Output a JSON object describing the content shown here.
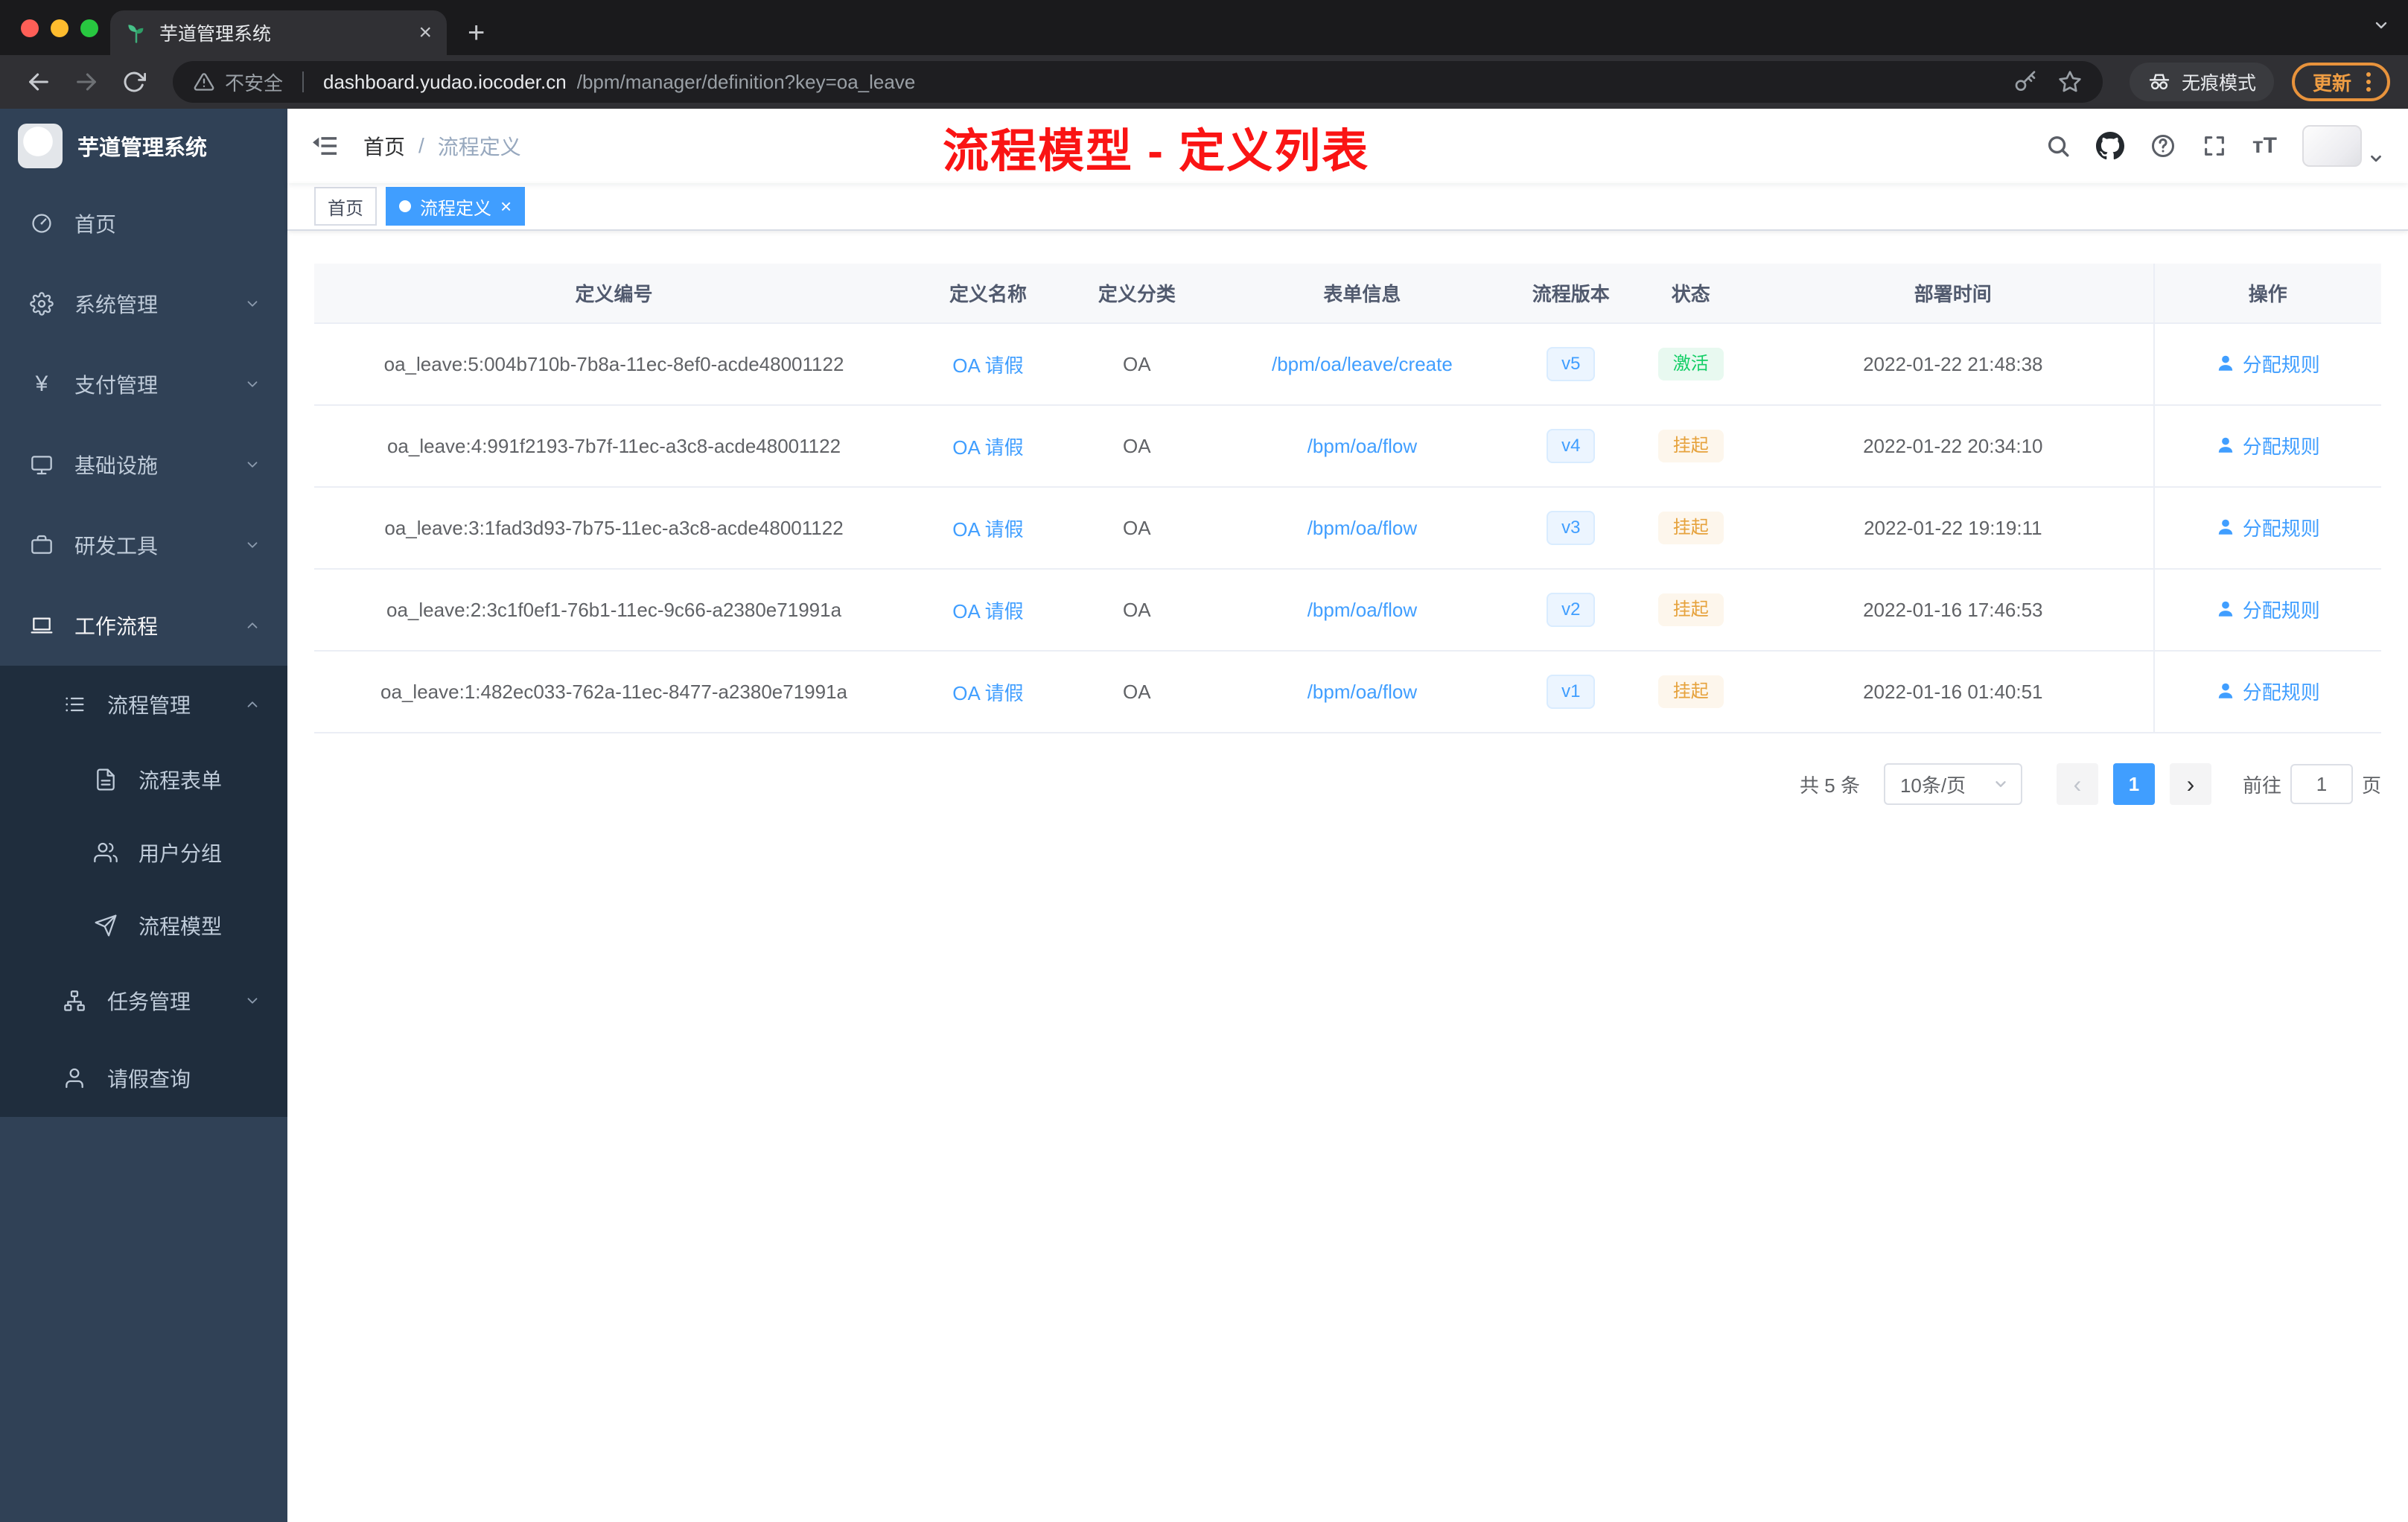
{
  "browser": {
    "tab_title": "芋道管理系统",
    "tab_close_glyph": "×",
    "new_tab_glyph": "+",
    "security_label": "不安全",
    "url_host": "dashboard.yudao.iocoder.cn",
    "url_path": "/bpm/manager/definition?key=oa_leave",
    "incognito_label": "无痕模式",
    "update_label": "更新"
  },
  "sidebar": {
    "logo_title": "芋道管理系统",
    "items": [
      {
        "label": "首页",
        "icon": "dashboard-icon"
      },
      {
        "label": "系统管理",
        "icon": "gear-icon"
      },
      {
        "label": "支付管理",
        "icon": "yen-icon",
        "glyph": "¥"
      },
      {
        "label": "基础设施",
        "icon": "monitor-icon"
      },
      {
        "label": "研发工具",
        "icon": "briefcase-icon"
      },
      {
        "label": "工作流程",
        "icon": "laptop-icon"
      },
      {
        "label": "流程管理",
        "icon": "list-icon"
      },
      {
        "label": "流程表单",
        "icon": "document-icon"
      },
      {
        "label": "用户分组",
        "icon": "users-icon"
      },
      {
        "label": "流程模型",
        "icon": "paper-plane-icon"
      },
      {
        "label": "任务管理",
        "icon": "org-tree-icon"
      },
      {
        "label": "请假查询",
        "icon": "user-icon"
      }
    ]
  },
  "header": {
    "breadcrumb": {
      "home": "首页",
      "separator": "/",
      "current": "流程定义"
    },
    "annotation": "流程模型 - 定义列表",
    "fontsize_glyph": "тT"
  },
  "tags": {
    "home": "首页",
    "active": "流程定义",
    "close_glyph": "×"
  },
  "table": {
    "columns": [
      "定义编号",
      "定义名称",
      "定义分类",
      "表单信息",
      "流程版本",
      "状态",
      "部署时间",
      "操作"
    ],
    "rows": [
      {
        "id": "oa_leave:5:004b710b-7b8a-11ec-8ef0-acde48001122",
        "name": "OA 请假",
        "category": "OA",
        "form": "/bpm/oa/leave/create",
        "version": "v5",
        "status": "激活",
        "time": "2022-01-22 21:48:38",
        "action": "分配规则"
      },
      {
        "id": "oa_leave:4:991f2193-7b7f-11ec-a3c8-acde48001122",
        "name": "OA 请假",
        "category": "OA",
        "form": "/bpm/oa/flow",
        "version": "v4",
        "status": "挂起",
        "time": "2022-01-22 20:34:10",
        "action": "分配规则"
      },
      {
        "id": "oa_leave:3:1fad3d93-7b75-11ec-a3c8-acde48001122",
        "name": "OA 请假",
        "category": "OA",
        "form": "/bpm/oa/flow",
        "version": "v3",
        "status": "挂起",
        "time": "2022-01-22 19:19:11",
        "action": "分配规则"
      },
      {
        "id": "oa_leave:2:3c1f0ef1-76b1-11ec-9c66-a2380e71991a",
        "name": "OA 请假",
        "category": "OA",
        "form": "/bpm/oa/flow",
        "version": "v2",
        "status": "挂起",
        "time": "2022-01-16 17:46:53",
        "action": "分配规则"
      },
      {
        "id": "oa_leave:1:482ec033-762a-11ec-8477-a2380e71991a",
        "name": "OA 请假",
        "category": "OA",
        "form": "/bpm/oa/flow",
        "version": "v1",
        "status": "挂起",
        "time": "2022-01-16 01:40:51",
        "action": "分配规则"
      }
    ]
  },
  "pagination": {
    "total": "共 5 条",
    "page_size": "10条/页",
    "prev_glyph": "‹",
    "page": "1",
    "next_glyph": "›",
    "goto_label": "前往",
    "goto_value": "1",
    "goto_unit": "页"
  },
  "colors": {
    "accent": "#409eff",
    "success": "#13ce66",
    "warning": "#e6a23c",
    "sidebar_bg": "#304156",
    "submenu_bg": "#1f2d3d",
    "annotation_red": "#fa1414",
    "update_orange": "#ef9d43"
  }
}
